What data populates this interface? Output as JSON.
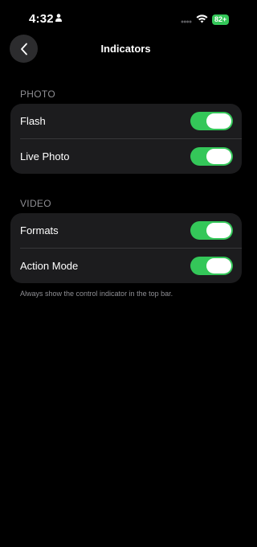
{
  "status_bar": {
    "time": "4:32",
    "battery": "82+"
  },
  "nav": {
    "title": "Indicators"
  },
  "sections": [
    {
      "header": "PHOTO",
      "rows": [
        {
          "label": "Flash",
          "on": true
        },
        {
          "label": "Live Photo",
          "on": true
        }
      ]
    },
    {
      "header": "VIDEO",
      "rows": [
        {
          "label": "Formats",
          "on": true
        },
        {
          "label": "Action Mode",
          "on": true
        }
      ]
    }
  ],
  "footer_note": "Always show the control indicator in the top bar.",
  "colors": {
    "accent_toggle": "#34c759",
    "background": "#000000",
    "group": "#1c1c1e",
    "secondary_text": "#8e8e93"
  },
  "icons": {
    "back": "chevron-left-icon",
    "person": "person-icon",
    "wifi": "wifi-icon",
    "signal": "signal-dots-icon"
  }
}
